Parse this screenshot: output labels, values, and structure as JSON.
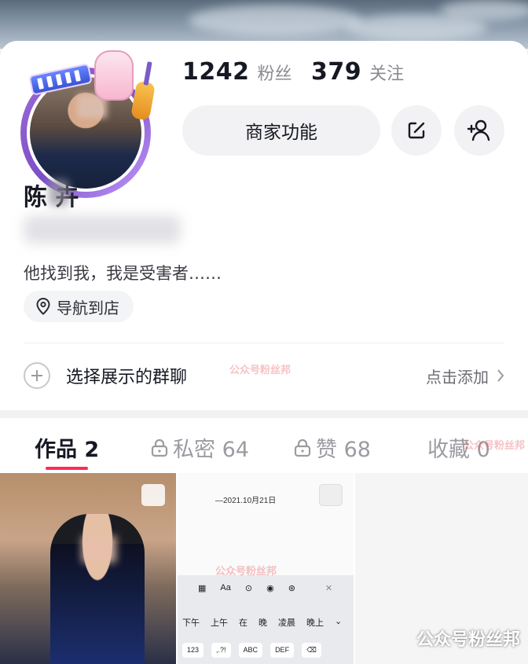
{
  "stats": {
    "followers": {
      "value": "1242",
      "label": "粉丝"
    },
    "following": {
      "value": "379",
      "label": "关注"
    }
  },
  "actions": {
    "merchant_label": "商家功能"
  },
  "profile": {
    "name": "陈 卉",
    "bio": "他找到我，我是受害者……",
    "nav_label": "导航到店"
  },
  "group_row": {
    "label": "选择展示的群聊",
    "action": "点击添加"
  },
  "tabs": [
    {
      "label": "作品 2",
      "active": true
    },
    {
      "label": "私密 64",
      "locked": true
    },
    {
      "label": "赞 68",
      "locked": true
    },
    {
      "label": "收藏 0"
    }
  ],
  "thumb2": {
    "date_text": "—2021.10月21日",
    "toolbar_labels": [
      "Aa"
    ],
    "candidates": [
      "下午",
      "上午",
      "在",
      "晚",
      "凌晨",
      "晚上"
    ],
    "keys": [
      "123",
      ",.?!",
      "ABC",
      "DEF"
    ]
  },
  "watermark": "公众号粉丝邦",
  "colors": {
    "accent": "#fe2c55",
    "avatar_ring": "#7b4fc6"
  }
}
